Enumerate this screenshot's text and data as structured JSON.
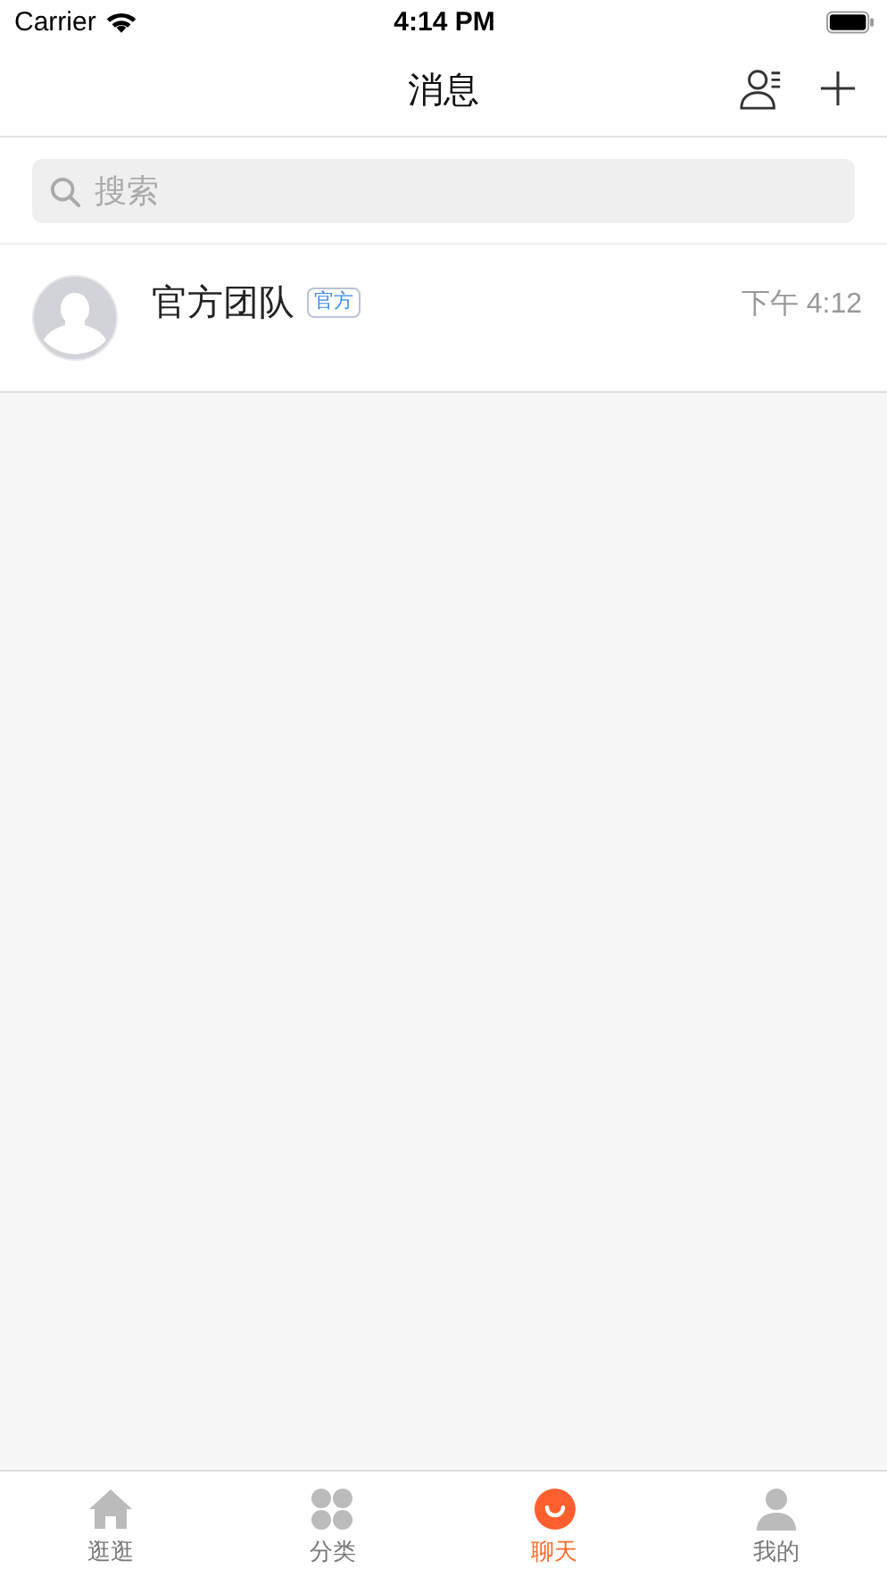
{
  "status_bar": {
    "carrier": "Carrier",
    "time": "4:14 PM"
  },
  "nav": {
    "title": "消息"
  },
  "search": {
    "placeholder": "搜索"
  },
  "conversations": [
    {
      "name": "官方团队",
      "badge": "官方",
      "time": "下午 4:12"
    }
  ],
  "tabs": [
    {
      "label": "逛逛",
      "kind": "home",
      "selected": false
    },
    {
      "label": "分类",
      "kind": "category",
      "selected": false
    },
    {
      "label": "聊天",
      "kind": "chat",
      "selected": true
    },
    {
      "label": "我的",
      "kind": "profile",
      "selected": false
    }
  ]
}
